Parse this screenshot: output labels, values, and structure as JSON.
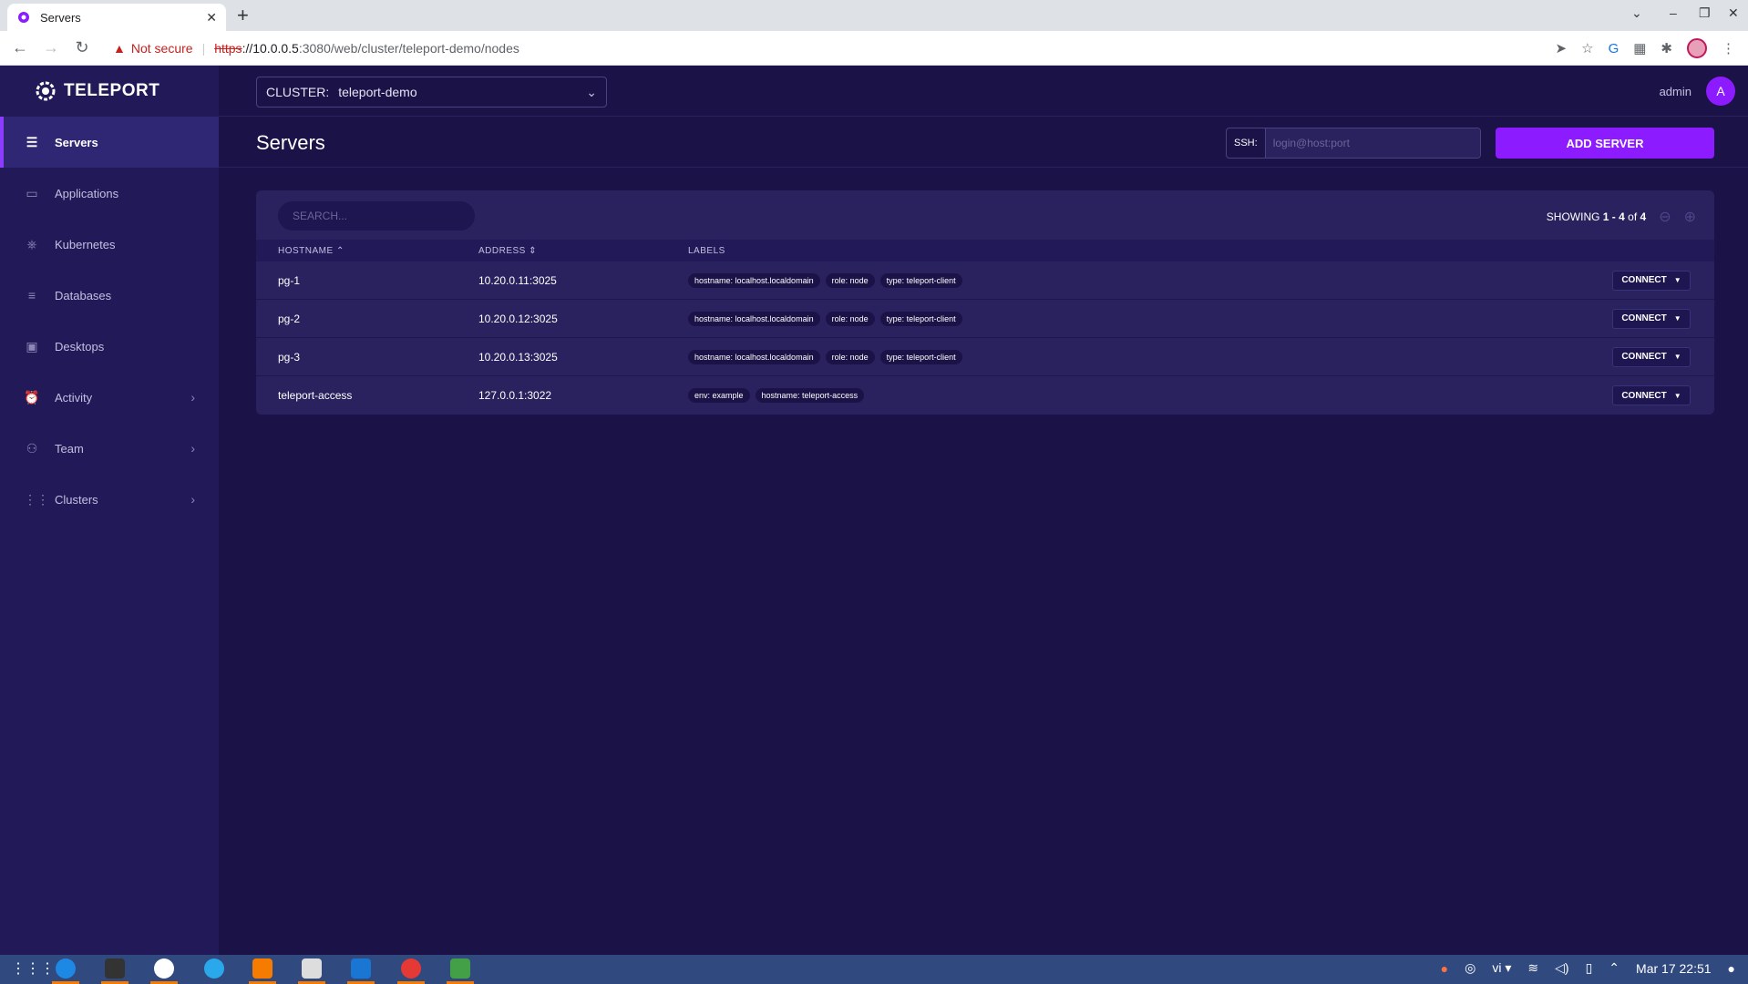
{
  "browser": {
    "tab_title": "Servers",
    "url_warning": "Not secure",
    "url_scheme": "https",
    "url_host": "://10.0.0.5",
    "url_rest": ":3080/web/cluster/teleport-demo/nodes"
  },
  "app": {
    "logo_text": "TELEPORT",
    "nav": [
      {
        "label": "Servers",
        "icon": "server-icon",
        "active": true
      },
      {
        "label": "Applications",
        "icon": "application-icon"
      },
      {
        "label": "Kubernetes",
        "icon": "kubernetes-icon"
      },
      {
        "label": "Databases",
        "icon": "database-icon"
      },
      {
        "label": "Desktops",
        "icon": "desktop-icon"
      },
      {
        "label": "Activity",
        "icon": "activity-icon",
        "expandable": true
      },
      {
        "label": "Team",
        "icon": "team-icon",
        "expandable": true
      },
      {
        "label": "Clusters",
        "icon": "clusters-icon",
        "expandable": true
      }
    ],
    "cluster_label": "CLUSTER:",
    "cluster_value": "teleport-demo",
    "username": "admin",
    "avatar_letter": "A",
    "page_title": "Servers",
    "ssh_label": "SSH:",
    "ssh_placeholder": "login@host:port",
    "add_server": "ADD SERVER",
    "search_placeholder": "SEARCH...",
    "paging": {
      "prefix": "SHOWING ",
      "range": "1 - 4",
      "of": " of ",
      "total": "4"
    },
    "columns": {
      "hostname": "HOSTNAME",
      "address": "ADDRESS",
      "labels": "LABELS"
    },
    "connect_label": "CONNECT",
    "rows": [
      {
        "hostname": "pg-1",
        "address": "10.20.0.11:3025",
        "labels": [
          "hostname: localhost.localdomain",
          "role: node",
          "type: teleport-client"
        ]
      },
      {
        "hostname": "pg-2",
        "address": "10.20.0.12:3025",
        "labels": [
          "hostname: localhost.localdomain",
          "role: node",
          "type: teleport-client"
        ]
      },
      {
        "hostname": "pg-3",
        "address": "10.20.0.13:3025",
        "labels": [
          "hostname: localhost.localdomain",
          "role: node",
          "type: teleport-client"
        ]
      },
      {
        "hostname": "teleport-access",
        "address": "127.0.0.1:3022",
        "labels": [
          "env: example",
          "hostname: teleport-access"
        ]
      }
    ]
  },
  "taskbar": {
    "keyboard": "vi",
    "datetime": "Mar 17  22:51"
  },
  "colors": {
    "accent": "#8c1bff",
    "sidebar": "#221a58",
    "background": "#1b1347"
  }
}
